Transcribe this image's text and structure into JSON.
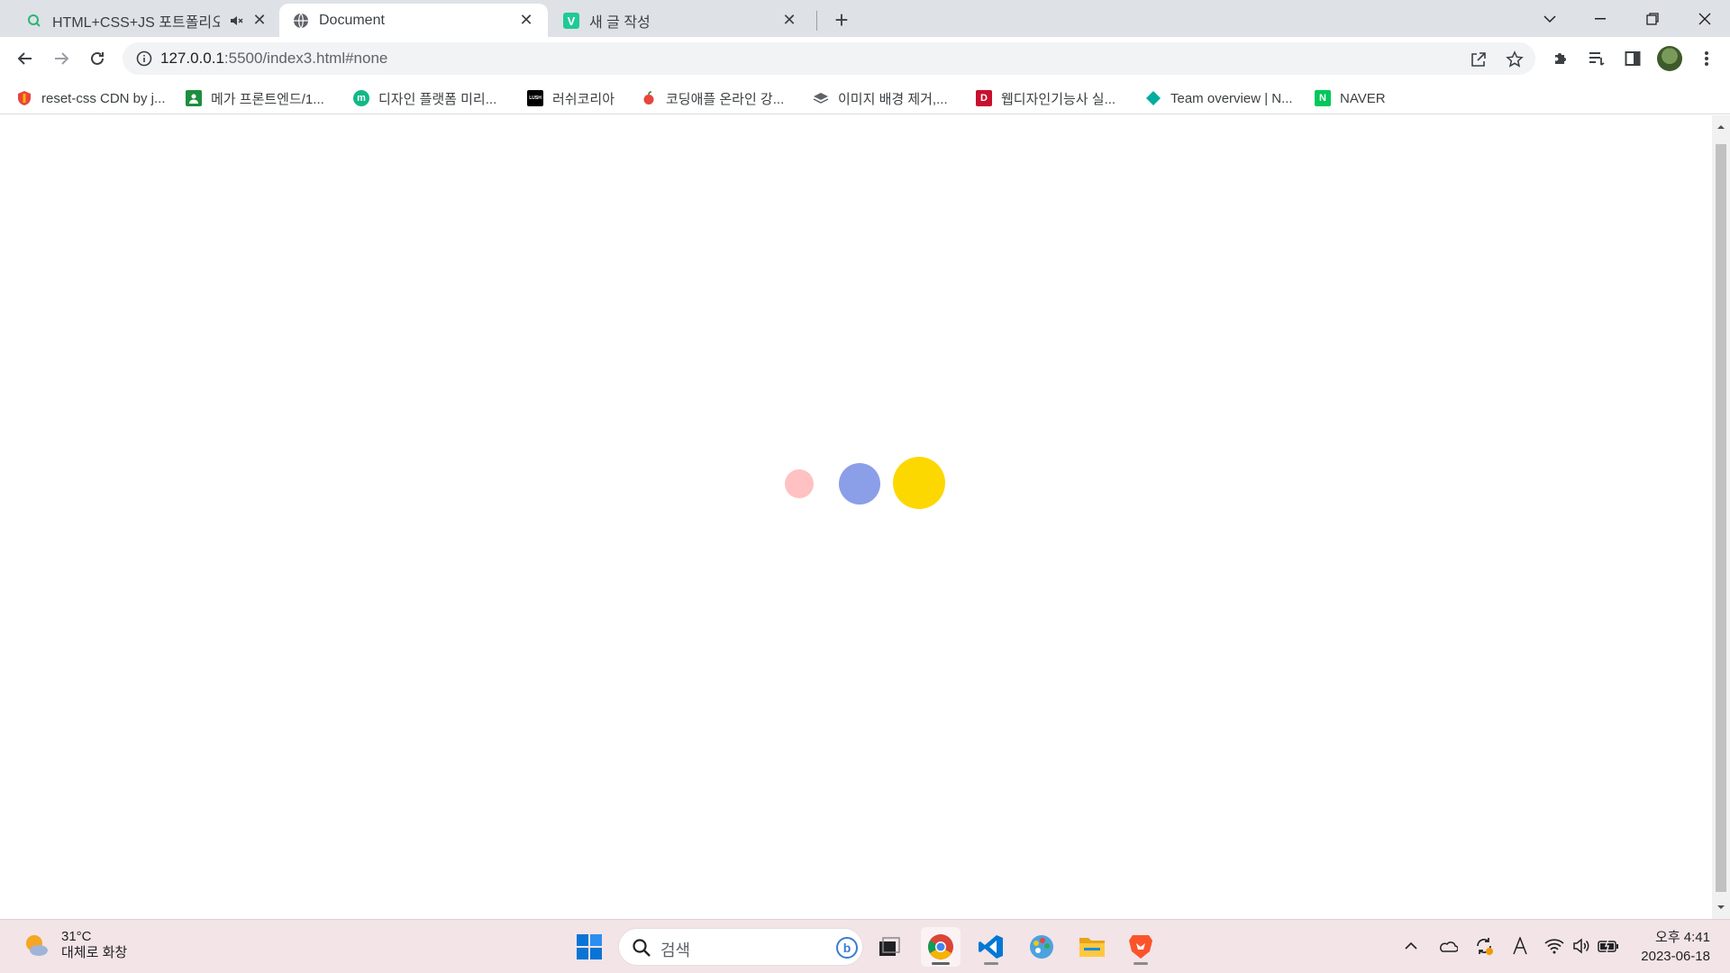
{
  "tabs": [
    {
      "title": "HTML+CSS+JS 포트폴리오 -",
      "favicon": "green-search-icon",
      "muted_icon": "speaker-muted-icon"
    },
    {
      "title": "Document",
      "favicon": "globe-icon",
      "active": true
    },
    {
      "title": "새 글 작성",
      "favicon": "velog-icon"
    }
  ],
  "address": {
    "host": "127.0.0.1",
    "path": ":5500/index3.html#none"
  },
  "bookmarks": [
    {
      "label": "reset-css CDN by j...",
      "icon": "shield-red-icon",
      "color": "#e8453c"
    },
    {
      "label": "메가 프론트엔드/1...",
      "icon": "green-contact-icon",
      "color": "#1e8e3e"
    },
    {
      "label": "디자인 플랫폼 미리...",
      "icon": "miri-m-icon",
      "color": "#12b886"
    },
    {
      "label": "러쉬코리아",
      "icon": "lush-icon",
      "color": "#000000"
    },
    {
      "label": "코딩애플 온라인 강...",
      "icon": "apple-icon",
      "color": "#e8453c"
    },
    {
      "label": "이미지 배경 제거,...",
      "icon": "layers-icon",
      "color": "#5f6368"
    },
    {
      "label": "웹디자인기능사 실...",
      "icon": "d-red-icon",
      "color": "#c8102e"
    },
    {
      "label": "Team overview | N...",
      "icon": "diamond-teal-icon",
      "color": "#00ad9f"
    },
    {
      "label": "NAVER",
      "icon": "naver-icon",
      "color": "#03c75a"
    }
  ],
  "loader": {
    "dots": [
      {
        "color": "#ffc1c1"
      },
      {
        "color": "#8b9ee8"
      },
      {
        "color": "#fcd800"
      }
    ]
  },
  "taskbar": {
    "weather": {
      "temp": "31°C",
      "desc": "대체로 화창"
    },
    "search_placeholder": "검색",
    "clock": {
      "time": "오후 4:41",
      "date": "2023-06-18"
    }
  }
}
